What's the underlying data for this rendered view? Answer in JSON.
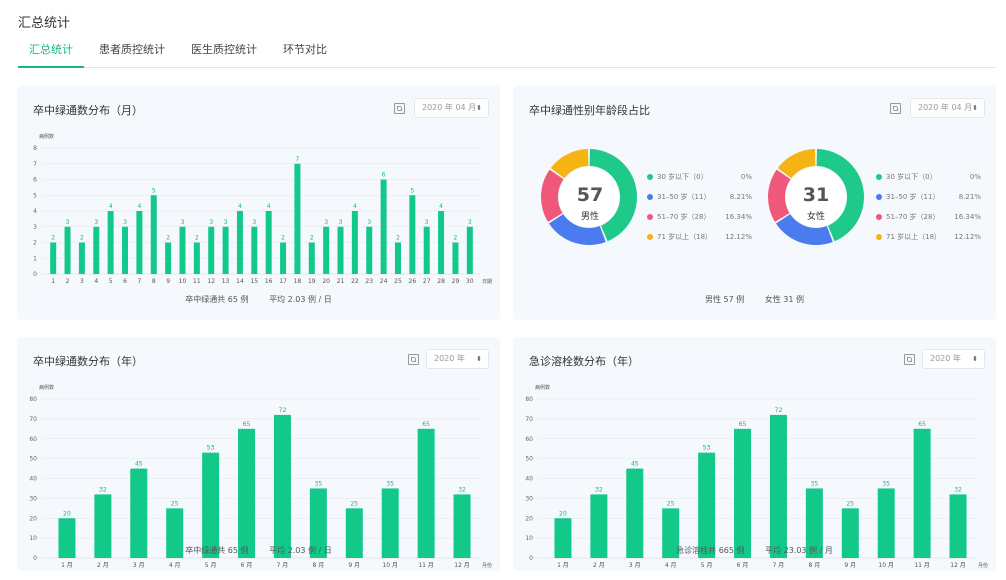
{
  "page": {
    "title": "汇总统计"
  },
  "tabs": [
    {
      "label": "汇总统计",
      "active": true
    },
    {
      "label": "患者质控统计",
      "active": false
    },
    {
      "label": "医生质控统计",
      "active": false
    },
    {
      "label": "环节对比",
      "active": false
    }
  ],
  "cards": {
    "monthly": {
      "title": "卒中绿通数分布（月）",
      "select": "2020 年 04 月",
      "summary_total": "卒中绿通共 65 例",
      "summary_avg": "平均 2.03 例 / 日"
    },
    "gender": {
      "title": "卒中绿通性别年龄段占比",
      "select": "2020 年 04 月",
      "summary_male": "男性 57 例",
      "summary_female": "女性 31 例"
    },
    "yearly": {
      "title": "卒中绿通数分布（年）",
      "select": "2020 年",
      "summary_total": "卒中绿通共 65 例",
      "summary_avg": "平均 2.03 例 / 日"
    },
    "thrombolysis": {
      "title": "急诊溶栓数分布（年）",
      "select": "2020 年",
      "summary_total": "急诊溶栓共 665 例",
      "summary_avg": "平均 23.03 例 / 月"
    }
  },
  "donuts": [
    {
      "number": "57",
      "label": "男性",
      "legend": [
        {
          "label": "30 岁以下（0）",
          "pct": "0%",
          "color": "#1ec98a"
        },
        {
          "label": "31–50 岁（11）",
          "pct": "8.21%",
          "color": "#4a7cf0"
        },
        {
          "label": "51–70 岁（28）",
          "pct": "16.34%",
          "color": "#f0587a"
        },
        {
          "label": "71 岁以上（18）",
          "pct": "12.12%",
          "color": "#f5b414"
        }
      ]
    },
    {
      "number": "31",
      "label": "女性",
      "legend": [
        {
          "label": "30 岁以下（0）",
          "pct": "0%",
          "color": "#1ec98a"
        },
        {
          "label": "31–50 岁（11）",
          "pct": "8.21%",
          "color": "#4a7cf0"
        },
        {
          "label": "51–70 岁（28）",
          "pct": "16.34%",
          "color": "#f0587a"
        },
        {
          "label": "71 岁以上（18）",
          "pct": "12.12%",
          "color": "#f5b414"
        }
      ]
    }
  ],
  "chart_data": [
    {
      "type": "bar",
      "title": "卒中绿通数分布（月）",
      "ylabel": "病例数",
      "xlabel": "日期",
      "categories": [
        "1",
        "2",
        "3",
        "4",
        "5",
        "6",
        "7",
        "8",
        "9",
        "10",
        "11",
        "12",
        "13",
        "14",
        "15",
        "16",
        "17",
        "18",
        "19",
        "20",
        "21",
        "22",
        "23",
        "24",
        "25",
        "26",
        "27",
        "28",
        "29",
        "30"
      ],
      "values": [
        2,
        3,
        2,
        3,
        4,
        3,
        4,
        5,
        2,
        3,
        2,
        3,
        3,
        4,
        3,
        4,
        2,
        7,
        2,
        3,
        3,
        4,
        3,
        6,
        2,
        5,
        3,
        4,
        2,
        3
      ],
      "ylim": [
        0,
        8
      ],
      "yticks": [
        0,
        1,
        2,
        3,
        4,
        5,
        6,
        7,
        8
      ],
      "color": "#13c98a"
    },
    {
      "type": "bar",
      "title": "卒中绿通数分布（年）",
      "ylabel": "病例数",
      "xlabel": "月份",
      "categories": [
        "1 月",
        "2 月",
        "3 月",
        "4 月",
        "5 月",
        "6 月",
        "7 月",
        "8 月",
        "9 月",
        "10 月",
        "11 月",
        "12 月"
      ],
      "values": [
        20,
        32,
        45,
        25,
        53,
        65,
        72,
        35,
        25,
        35,
        65,
        32
      ],
      "ylim": [
        0,
        80
      ],
      "yticks": [
        0,
        10,
        20,
        30,
        40,
        50,
        60,
        70,
        80
      ],
      "color": "#13c98a"
    },
    {
      "type": "bar",
      "title": "急诊溶栓数分布（年）",
      "ylabel": "病例数",
      "xlabel": "月份",
      "categories": [
        "1 月",
        "2 月",
        "3 月",
        "4 月",
        "5 月",
        "6 月",
        "7 月",
        "8 月",
        "9 月",
        "10 月",
        "11 月",
        "12 月"
      ],
      "values": [
        20,
        32,
        45,
        25,
        53,
        65,
        72,
        35,
        25,
        35,
        65,
        32
      ],
      "ylim": [
        0,
        80
      ],
      "yticks": [
        0,
        10,
        20,
        30,
        40,
        50,
        60,
        70,
        80
      ],
      "color": "#13c98a"
    },
    {
      "type": "pie",
      "title": "男性",
      "categories": [
        "30 岁以下",
        "31–50 岁",
        "51–70 岁",
        "71 岁以上"
      ],
      "values": [
        0,
        11,
        28,
        18
      ]
    },
    {
      "type": "pie",
      "title": "女性",
      "categories": [
        "30 岁以下",
        "31–50 岁",
        "51–70 岁",
        "71 岁以上"
      ],
      "values": [
        0,
        11,
        28,
        18
      ]
    }
  ]
}
